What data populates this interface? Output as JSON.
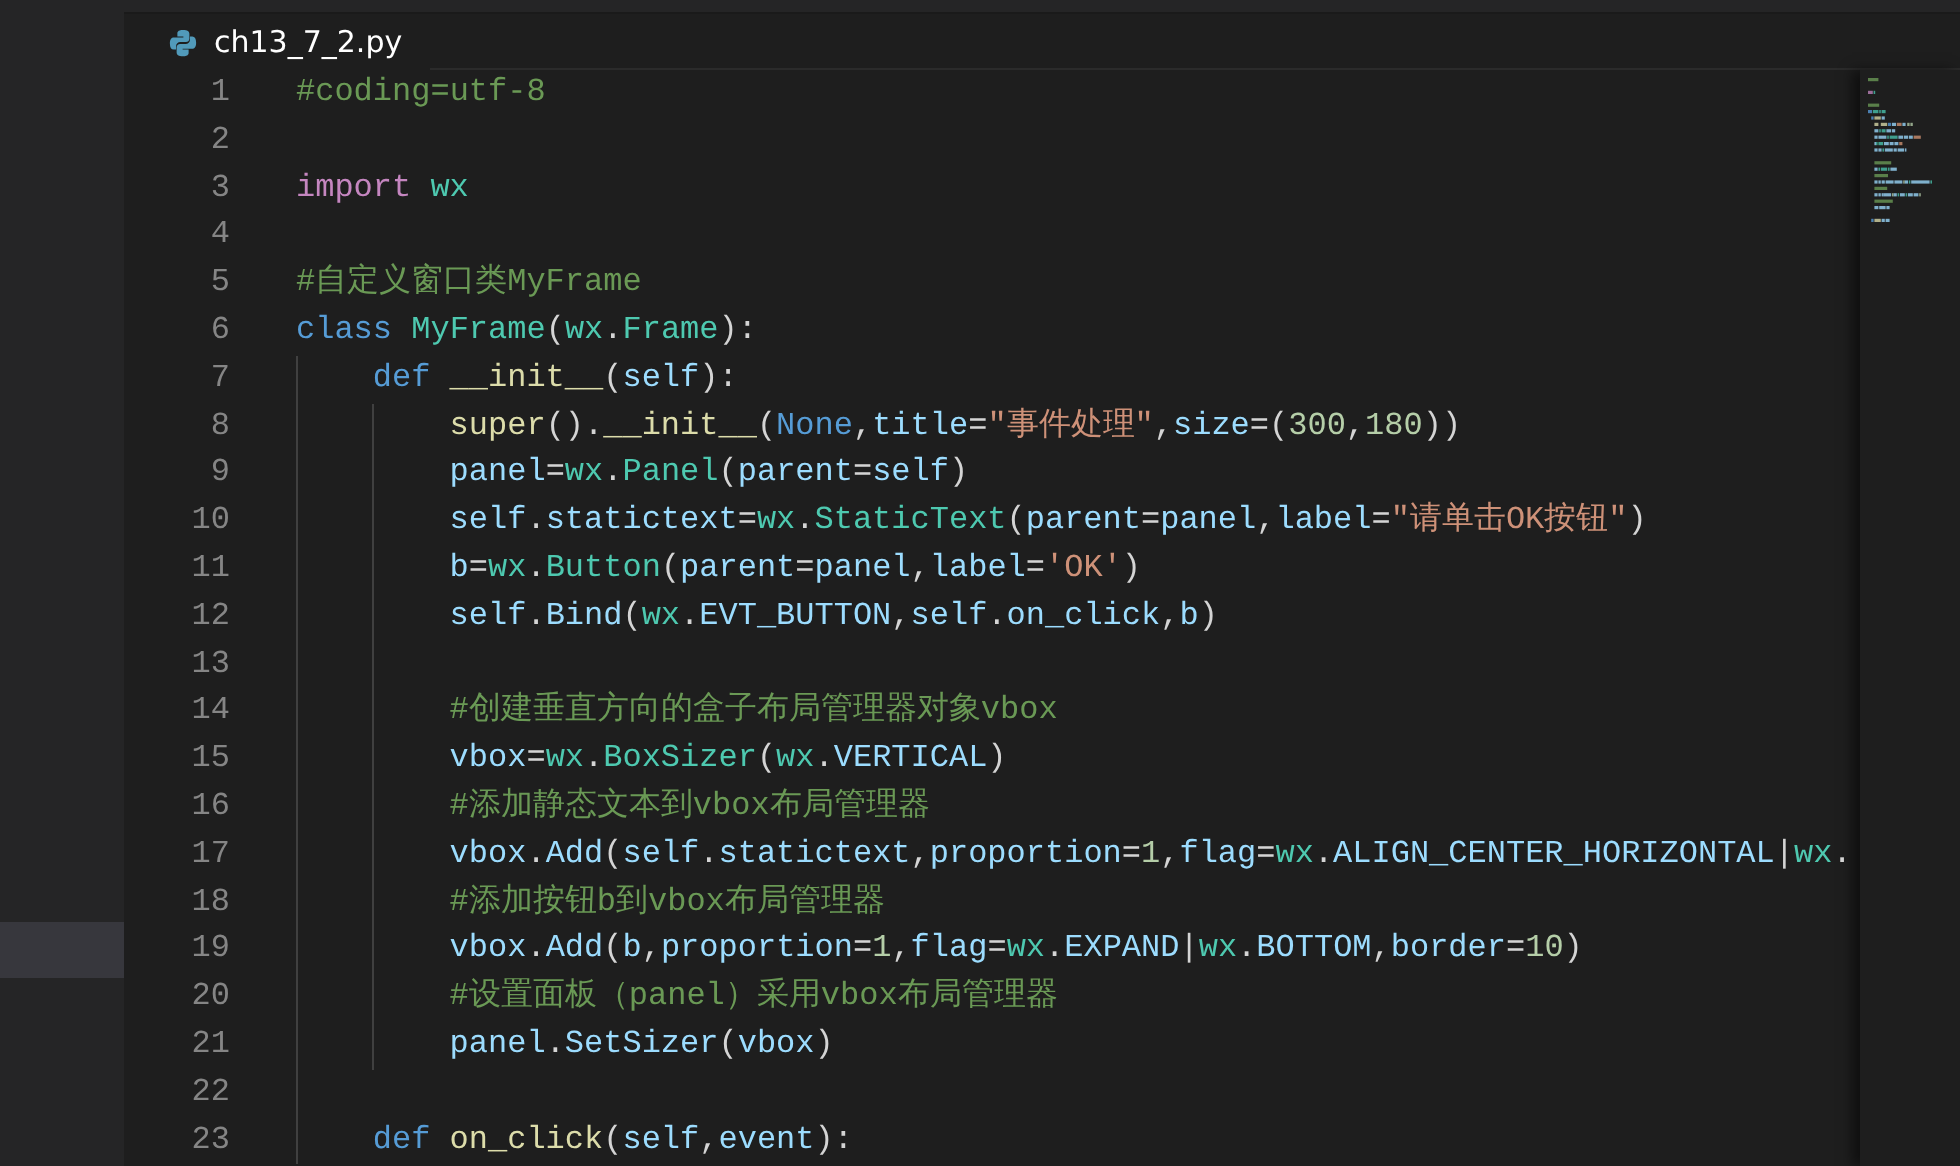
{
  "tab": {
    "title": "ch13_7_2.py",
    "selected": true
  },
  "lines": [
    {
      "number": "1",
      "tokens": [
        {
          "kind": "comment",
          "text": "#coding=utf-8"
        }
      ]
    },
    {
      "number": "2"
    },
    {
      "number": "3",
      "tokens": [
        {
          "kind": "control",
          "text": "import"
        },
        {
          "kind": "type",
          "text": "wx",
          "spaced": true
        }
      ]
    },
    {
      "number": "4"
    },
    {
      "number": "5",
      "tokens": [
        {
          "kind": "comment",
          "text": "#自定义窗口类MyFrame"
        }
      ]
    },
    {
      "number": "6",
      "tokens": [
        {
          "kind": "keyword",
          "text": "class"
        },
        {
          "kind": "type",
          "text": "MyFrame",
          "spaced": true
        },
        {
          "kind": "plain",
          "text": "("
        },
        {
          "kind": "type",
          "text": "wx"
        },
        {
          "kind": "plain",
          "text": "."
        },
        {
          "kind": "type",
          "text": "Frame"
        },
        {
          "kind": "plain",
          "text": "):"
        }
      ],
      "children": [
        {
          "number": "7",
          "tokens": [
            {
              "kind": "keyword",
              "text": "def"
            },
            {
              "kind": "function",
              "text": "__init__",
              "spaced": true
            },
            {
              "kind": "plain",
              "text": "("
            },
            {
              "kind": "variable",
              "text": "self"
            },
            {
              "kind": "plain",
              "text": "):"
            }
          ],
          "children": [
            {
              "number": "8",
              "tokens": [
                {
                  "kind": "function",
                  "text": "super"
                },
                {
                  "kind": "plain",
                  "text": "()."
                },
                {
                  "kind": "function",
                  "text": "__init__"
                },
                {
                  "kind": "plain",
                  "text": "("
                },
                {
                  "kind": "keyword",
                  "text": "None"
                },
                {
                  "kind": "plain",
                  "text": ","
                },
                {
                  "kind": "variable",
                  "text": "title"
                },
                {
                  "kind": "plain",
                  "text": "="
                },
                {
                  "kind": "string",
                  "text": "\"事件处理\""
                },
                {
                  "kind": "plain",
                  "text": ","
                },
                {
                  "kind": "variable",
                  "text": "size"
                },
                {
                  "kind": "plain",
                  "text": "=("
                },
                {
                  "kind": "number",
                  "text": "300"
                },
                {
                  "kind": "plain",
                  "text": ","
                },
                {
                  "kind": "number",
                  "text": "180"
                },
                {
                  "kind": "plain",
                  "text": "))"
                }
              ]
            },
            {
              "number": "9",
              "tokens": [
                {
                  "kind": "variable",
                  "text": "panel"
                },
                {
                  "kind": "plain",
                  "text": "="
                },
                {
                  "kind": "type",
                  "text": "wx"
                },
                {
                  "kind": "plain",
                  "text": "."
                },
                {
                  "kind": "type",
                  "text": "Panel"
                },
                {
                  "kind": "plain",
                  "text": "("
                },
                {
                  "kind": "variable",
                  "text": "parent"
                },
                {
                  "kind": "plain",
                  "text": "="
                },
                {
                  "kind": "variable",
                  "text": "self"
                },
                {
                  "kind": "plain",
                  "text": ")"
                }
              ]
            },
            {
              "number": "10",
              "tokens": [
                {
                  "kind": "variable",
                  "text": "self"
                },
                {
                  "kind": "plain",
                  "text": "."
                },
                {
                  "kind": "variable",
                  "text": "statictext"
                },
                {
                  "kind": "plain",
                  "text": "="
                },
                {
                  "kind": "type",
                  "text": "wx"
                },
                {
                  "kind": "plain",
                  "text": "."
                },
                {
                  "kind": "type",
                  "text": "StaticText"
                },
                {
                  "kind": "plain",
                  "text": "("
                },
                {
                  "kind": "variable",
                  "text": "parent"
                },
                {
                  "kind": "plain",
                  "text": "="
                },
                {
                  "kind": "variable",
                  "text": "panel"
                },
                {
                  "kind": "plain",
                  "text": ","
                },
                {
                  "kind": "variable",
                  "text": "label"
                },
                {
                  "kind": "plain",
                  "text": "="
                },
                {
                  "kind": "string",
                  "text": "\"请单击OK按钮\""
                },
                {
                  "kind": "plain",
                  "text": ")"
                }
              ]
            },
            {
              "number": "11",
              "tokens": [
                {
                  "kind": "variable",
                  "text": "b"
                },
                {
                  "kind": "plain",
                  "text": "="
                },
                {
                  "kind": "type",
                  "text": "wx"
                },
                {
                  "kind": "plain",
                  "text": "."
                },
                {
                  "kind": "type",
                  "text": "Button"
                },
                {
                  "kind": "plain",
                  "text": "("
                },
                {
                  "kind": "variable",
                  "text": "parent"
                },
                {
                  "kind": "plain",
                  "text": "="
                },
                {
                  "kind": "variable",
                  "text": "panel"
                },
                {
                  "kind": "plain",
                  "text": ","
                },
                {
                  "kind": "variable",
                  "text": "label"
                },
                {
                  "kind": "plain",
                  "text": "="
                },
                {
                  "kind": "string",
                  "text": "'OK'"
                },
                {
                  "kind": "plain",
                  "text": ")"
                }
              ]
            },
            {
              "number": "12",
              "tokens": [
                {
                  "kind": "variable",
                  "text": "self"
                },
                {
                  "kind": "plain",
                  "text": "."
                },
                {
                  "kind": "variable",
                  "text": "Bind"
                },
                {
                  "kind": "plain",
                  "text": "("
                },
                {
                  "kind": "type",
                  "text": "wx"
                },
                {
                  "kind": "plain",
                  "text": "."
                },
                {
                  "kind": "variable",
                  "text": "EVT_BUTTON"
                },
                {
                  "kind": "plain",
                  "text": ","
                },
                {
                  "kind": "variable",
                  "text": "self"
                },
                {
                  "kind": "plain",
                  "text": "."
                },
                {
                  "kind": "variable",
                  "text": "on_click"
                },
                {
                  "kind": "plain",
                  "text": ","
                },
                {
                  "kind": "variable",
                  "text": "b"
                },
                {
                  "kind": "plain",
                  "text": ")"
                }
              ]
            },
            {
              "number": "13"
            },
            {
              "number": "14",
              "tokens": [
                {
                  "kind": "comment",
                  "text": "#创建垂直方向的盒子布局管理器对象vbox"
                }
              ]
            },
            {
              "number": "15",
              "tokens": [
                {
                  "kind": "variable",
                  "text": "vbox"
                },
                {
                  "kind": "plain",
                  "text": "="
                },
                {
                  "kind": "type",
                  "text": "wx"
                },
                {
                  "kind": "plain",
                  "text": "."
                },
                {
                  "kind": "type",
                  "text": "BoxSizer"
                },
                {
                  "kind": "plain",
                  "text": "("
                },
                {
                  "kind": "type",
                  "text": "wx"
                },
                {
                  "kind": "plain",
                  "text": "."
                },
                {
                  "kind": "variable",
                  "text": "VERTICAL"
                },
                {
                  "kind": "plain",
                  "text": ")"
                }
              ]
            },
            {
              "number": "16",
              "tokens": [
                {
                  "kind": "comment",
                  "text": "#添加静态文本到vbox布局管理器"
                }
              ]
            },
            {
              "number": "17",
              "tokens": [
                {
                  "kind": "variable",
                  "text": "vbox"
                },
                {
                  "kind": "plain",
                  "text": "."
                },
                {
                  "kind": "variable",
                  "text": "Add"
                },
                {
                  "kind": "plain",
                  "text": "("
                },
                {
                  "kind": "variable",
                  "text": "self"
                },
                {
                  "kind": "plain",
                  "text": "."
                },
                {
                  "kind": "variable",
                  "text": "statictext"
                },
                {
                  "kind": "plain",
                  "text": ","
                },
                {
                  "kind": "variable",
                  "text": "proportion"
                },
                {
                  "kind": "plain",
                  "text": "="
                },
                {
                  "kind": "number",
                  "text": "1"
                },
                {
                  "kind": "plain",
                  "text": ","
                },
                {
                  "kind": "variable",
                  "text": "flag"
                },
                {
                  "kind": "plain",
                  "text": "="
                },
                {
                  "kind": "type",
                  "text": "wx"
                },
                {
                  "kind": "plain",
                  "text": "."
                },
                {
                  "kind": "variable",
                  "text": "ALIGN_CENTER_HORIZONTAL"
                },
                {
                  "kind": "plain",
                  "text": "|"
                },
                {
                  "kind": "type",
                  "text": "wx"
                },
                {
                  "kind": "plain",
                  "text": "."
                }
              ]
            },
            {
              "number": "18",
              "tokens": [
                {
                  "kind": "comment",
                  "text": "#添加按钮b到vbox布局管理器"
                }
              ]
            },
            {
              "number": "19",
              "tokens": [
                {
                  "kind": "variable",
                  "text": "vbox"
                },
                {
                  "kind": "plain",
                  "text": "."
                },
                {
                  "kind": "variable",
                  "text": "Add"
                },
                {
                  "kind": "plain",
                  "text": "("
                },
                {
                  "kind": "variable",
                  "text": "b"
                },
                {
                  "kind": "plain",
                  "text": ","
                },
                {
                  "kind": "variable",
                  "text": "proportion"
                },
                {
                  "kind": "plain",
                  "text": "="
                },
                {
                  "kind": "number",
                  "text": "1"
                },
                {
                  "kind": "plain",
                  "text": ","
                },
                {
                  "kind": "variable",
                  "text": "flag"
                },
                {
                  "kind": "plain",
                  "text": "="
                },
                {
                  "kind": "type",
                  "text": "wx"
                },
                {
                  "kind": "plain",
                  "text": "."
                },
                {
                  "kind": "variable",
                  "text": "EXPAND"
                },
                {
                  "kind": "plain",
                  "text": "|"
                },
                {
                  "kind": "type",
                  "text": "wx"
                },
                {
                  "kind": "plain",
                  "text": "."
                },
                {
                  "kind": "variable",
                  "text": "BOTTOM"
                },
                {
                  "kind": "plain",
                  "text": ","
                },
                {
                  "kind": "variable",
                  "text": "border"
                },
                {
                  "kind": "plain",
                  "text": "="
                },
                {
                  "kind": "number",
                  "text": "10"
                },
                {
                  "kind": "plain",
                  "text": ")"
                }
              ]
            },
            {
              "number": "20",
              "tokens": [
                {
                  "kind": "comment",
                  "text": "#设置面板（panel）采用vbox布局管理器"
                }
              ]
            },
            {
              "number": "21",
              "tokens": [
                {
                  "kind": "variable",
                  "text": "panel"
                },
                {
                  "kind": "plain",
                  "text": "."
                },
                {
                  "kind": "variable",
                  "text": "SetSizer"
                },
                {
                  "kind": "plain",
                  "text": "("
                },
                {
                  "kind": "variable",
                  "text": "vbox"
                },
                {
                  "kind": "plain",
                  "text": ")"
                }
              ]
            }
          ]
        },
        {
          "number": "22"
        },
        {
          "number": "23",
          "tokens": [
            {
              "kind": "keyword",
              "text": "def"
            },
            {
              "kind": "function",
              "text": "on_click",
              "spaced": true
            },
            {
              "kind": "plain",
              "text": "("
            },
            {
              "kind": "variable",
              "text": "self"
            },
            {
              "kind": "plain",
              "text": ","
            },
            {
              "kind": "variable",
              "text": "event"
            },
            {
              "kind": "plain",
              "text": "):"
            }
          ]
        }
      ]
    }
  ]
}
